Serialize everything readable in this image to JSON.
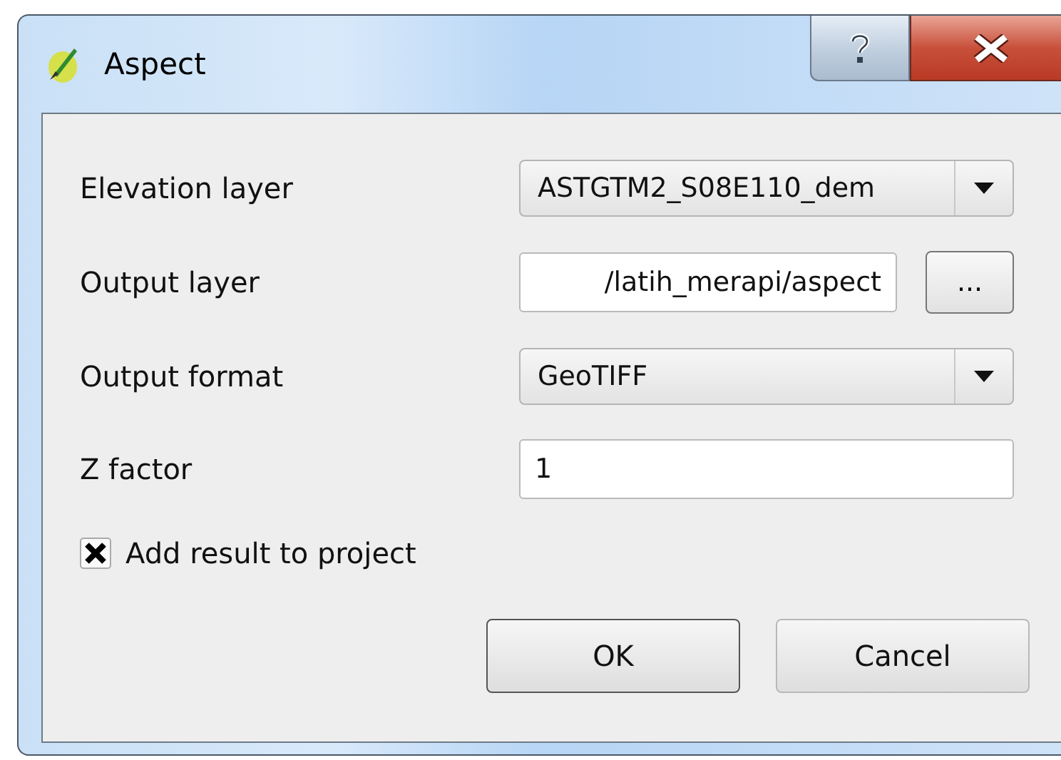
{
  "window": {
    "title": "Aspect"
  },
  "fields": [
    {
      "kind": "combo",
      "label": "Elevation layer",
      "value": "ASTGTM2_S08E110_dem"
    },
    {
      "kind": "file",
      "label": "Output layer",
      "value": "/latih_merapi/aspect",
      "button": "..."
    },
    {
      "kind": "combo",
      "label": "Output format",
      "value": "GeoTIFF"
    },
    {
      "kind": "text",
      "label": "Z factor",
      "value": "1"
    }
  ],
  "checkbox": {
    "label": "Add result to project",
    "checked": true
  },
  "buttons": [
    {
      "label": "OK",
      "default": true
    },
    {
      "label": "Cancel",
      "default": false
    }
  ]
}
